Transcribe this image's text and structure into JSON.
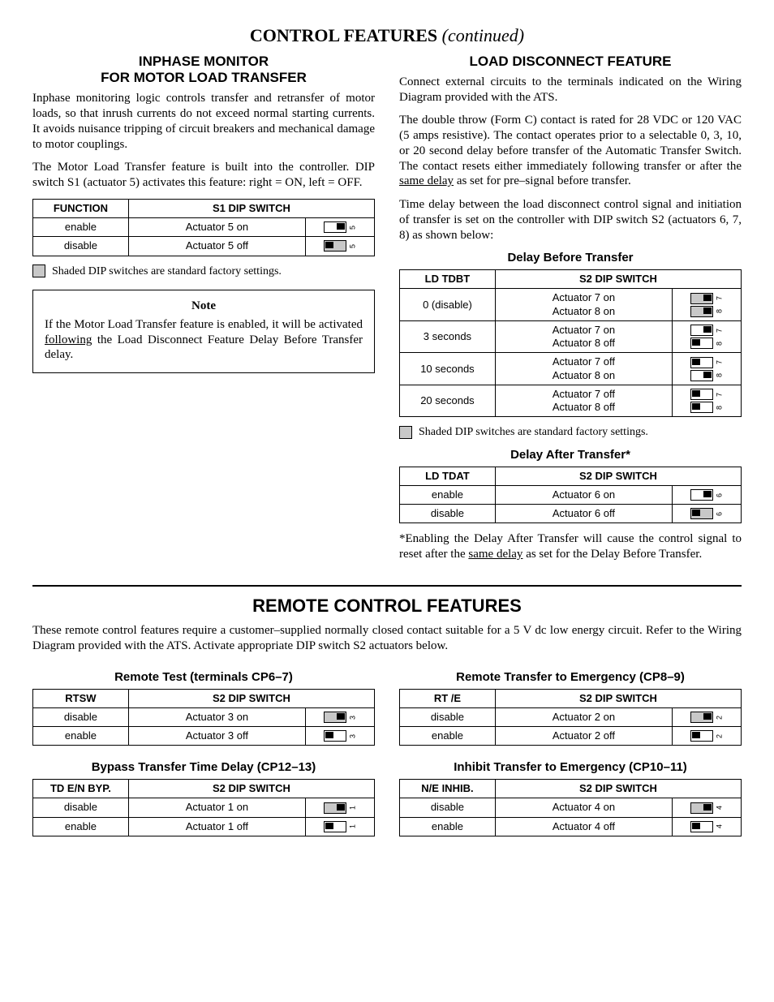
{
  "title_bold": "CONTROL FEATURES",
  "title_ital": "(continued)",
  "left": {
    "heading": "INPHASE MONITOR\nFOR MOTOR LOAD TRANSFER",
    "p1": "Inphase monitoring logic controls transfer and retransfer of motor loads, so that inrush currents do not exceed normal starting currents. It avoids nuisance tripping of circuit breakers and mechanical damage to motor couplings.",
    "p2": "The Motor Load Transfer feature is built into the controller.  DIP switch S1 (actuator 5) activates this feature:  right = ON, left = OFF.",
    "tbl": {
      "h1": "FUNCTION",
      "h2": "S1 DIP SWITCH",
      "r1c1": "enable",
      "r1c2": "Actuator 5 on",
      "r1num": "5",
      "r2c1": "disable",
      "r2c2": "Actuator 5 off",
      "r2num": "5"
    },
    "legend": "Shaded DIP switches are standard factory settings.",
    "note_t": "Note",
    "note_a": "If the Motor Load Transfer feature is enabled, it will be activated ",
    "note_u": "following",
    "note_b": " the Load Disconnect Feature Delay Before Transfer delay."
  },
  "right": {
    "heading": "LOAD DISCONNECT FEATURE",
    "p1": "Connect external circuits to the terminals indicated on the Wiring Diagram provided with the ATS.",
    "p2": "The double throw (Form C) contact is rated for 28 VDC or 120 VAC (5 amps resistive).  The contact operates prior to a selectable 0, 3, 10, or 20 second delay before transfer of the Automatic Transfer Switch.  The contact resets either immediately following transfer or after the ",
    "p2u": "same delay",
    "p2b": " as set for pre–signal before transfer.",
    "p3": "Time delay between the load disconnect control signal and initiation of transfer is set on the controller with DIP switch S2 (actuators 6, 7, 8) as shown below:",
    "dbt_h": "Delay Before Transfer",
    "dbt": {
      "h1": "LD TDBT",
      "h2": "S2 DIP SWITCH",
      "r1c1": "0 (disable)",
      "r1a": "Actuator 7 on",
      "r1b": "Actuator 8 on",
      "r2c1": "3 seconds",
      "r2a": "Actuator 7 on",
      "r2b": "Actuator 8 off",
      "r3c1": "10 seconds",
      "r3a": "Actuator 7 off",
      "r3b": "Actuator 8 on",
      "r4c1": "20 seconds",
      "r4a": "Actuator 7 off",
      "r4b": "Actuator 8 off"
    },
    "legend": "Shaded DIP switches are standard factory settings.",
    "dat_h": "Delay After Transfer*",
    "dat": {
      "h1": "LD TDAT",
      "h2": "S2 DIP SWITCH",
      "r1c1": "enable",
      "r1c2": "Actuator 6 on",
      "r1n": "6",
      "r2c1": "disable",
      "r2c2": "Actuator 6 off",
      "r2n": "6"
    },
    "foot_a": "*Enabling the Delay After Transfer will cause the control signal to reset after the ",
    "foot_u": "same delay",
    "foot_b": " as set for the Delay Before Transfer."
  },
  "remote": {
    "title": "REMOTE CONTROL FEATURES",
    "intro": "These remote control features require a customer–supplied normally closed contact suitable for a 5 V dc low energy circuit.  Refer to the Wiring Diagram provided with the ATS.  Activate appropriate DIP switch S2 actuators below.",
    "rt_h": "Remote Test (terminals CP6–7)",
    "rt": {
      "h1": "RTSW",
      "h2": "S2 DIP SWITCH",
      "r1c1": "disable",
      "r1c2": "Actuator 3 on",
      "r1n": "3",
      "r2c1": "enable",
      "r2c2": "Actuator 3 off",
      "r2n": "3"
    },
    "byp_h": "Bypass Transfer Time Delay (CP12–13)",
    "byp": {
      "h1": "TD E/N BYP.",
      "h2": "S2 DIP SWITCH",
      "r1c1": "disable",
      "r1c2": "Actuator 1 on",
      "r1n": "1",
      "r2c1": "enable",
      "r2c2": "Actuator 1 off",
      "r2n": "1"
    },
    "rte_h": "Remote Transfer to Emergency (CP8–9)",
    "rte": {
      "h1": "RT /E",
      "h2": "S2 DIP SWITCH",
      "r1c1": "disable",
      "r1c2": "Actuator 2 on",
      "r1n": "2",
      "r2c1": "enable",
      "r2c2": "Actuator 2 off",
      "r2n": "2"
    },
    "inh_h": "Inhibit Transfer to Emergency (CP10–11)",
    "inh": {
      "h1": "N/E INHIB.",
      "h2": "S2 DIP SWITCH",
      "r1c1": "disable",
      "r1c2": "Actuator 4 on",
      "r1n": "4",
      "r2c1": "enable",
      "r2c2": "Actuator 4 off",
      "r2n": "4"
    }
  }
}
